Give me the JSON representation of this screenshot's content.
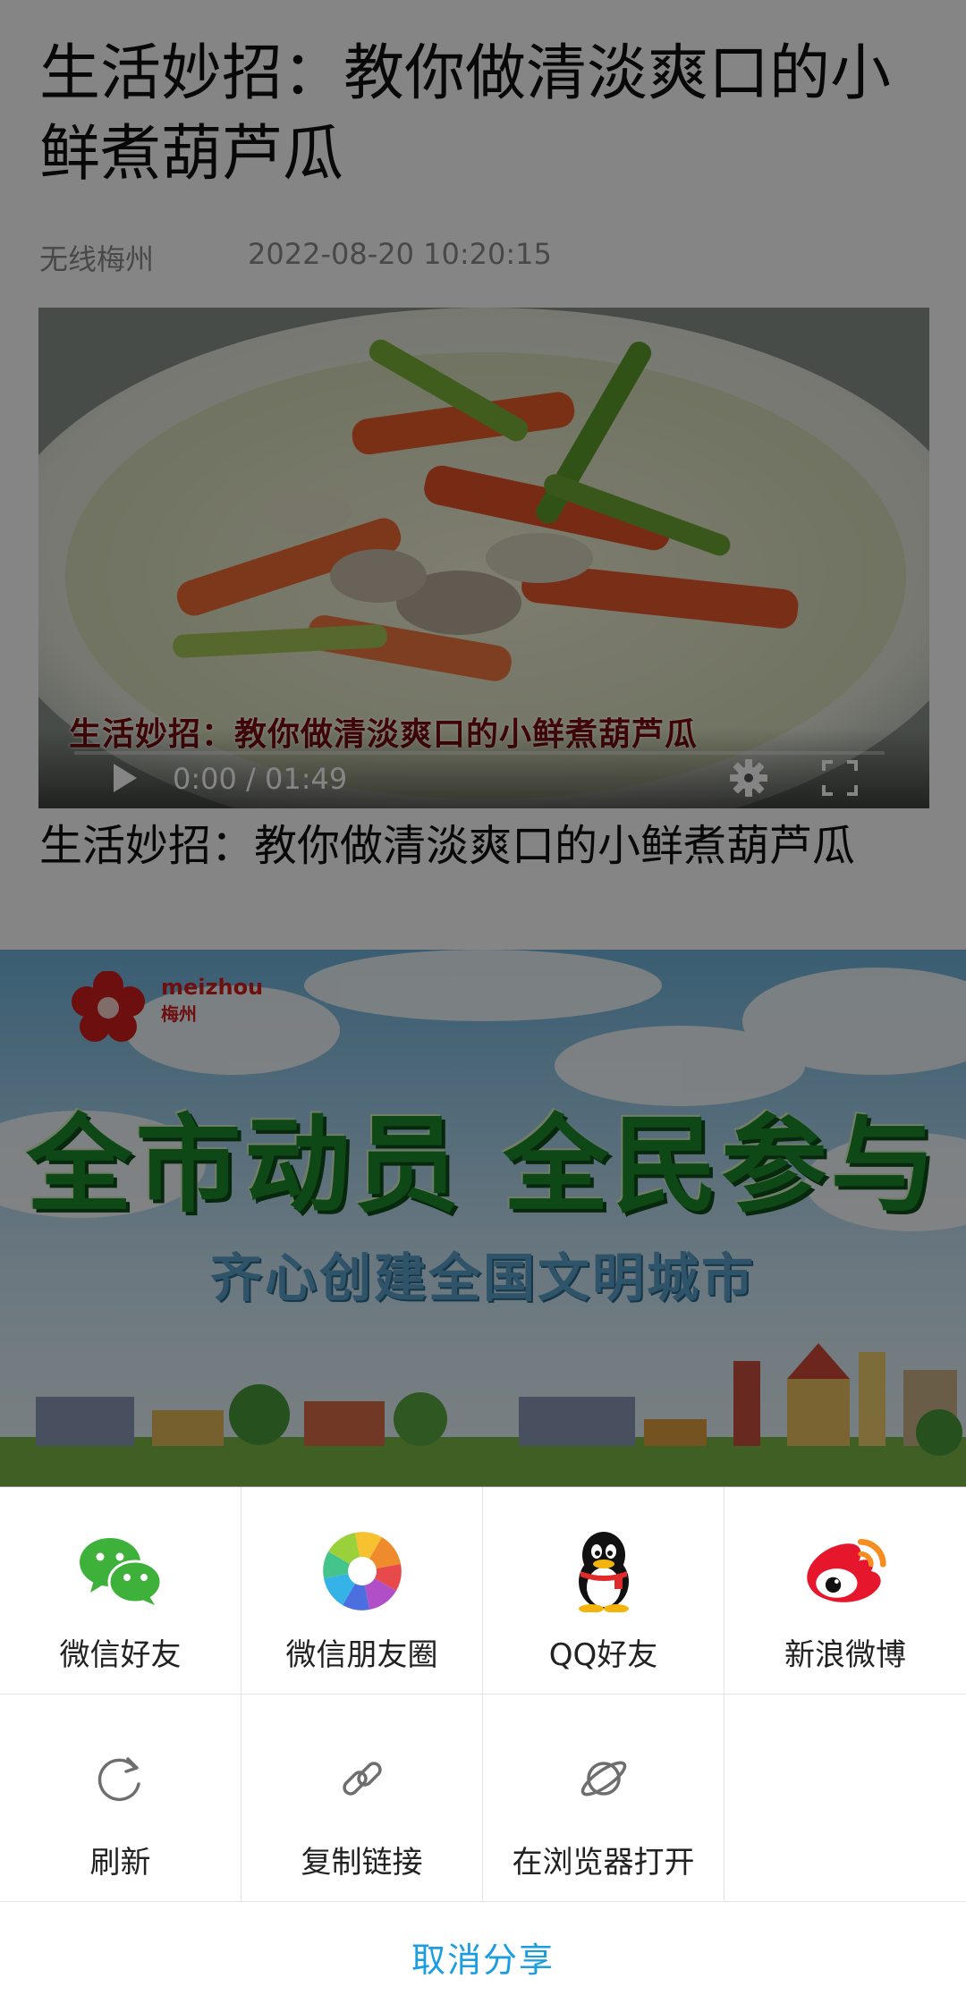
{
  "article": {
    "title": "生活妙招：教你做清淡爽口的小鲜煮葫芦瓜",
    "source": "无线梅州",
    "datetime": "2022-08-20 10:20:15",
    "video": {
      "overlay_caption": "生活妙招：教你做清淡爽口的小鲜煮葫芦瓜",
      "time_readout": "0:00 / 01:49",
      "progress": 0,
      "icons": {
        "play": "play-icon",
        "settings": "gear-icon",
        "fullscreen": "fullscreen-icon"
      }
    },
    "subtitle": "生活妙招：教你做清淡爽口的小鲜煮葫芦瓜",
    "banner": {
      "logo_en": "meizhou",
      "logo_cn": "梅州",
      "headline": "全市动员 全民参与",
      "subline": "齐心创建全国文明城市"
    }
  },
  "share_sheet": {
    "options": [
      {
        "label": "微信好友",
        "icon": "wechat-icon"
      },
      {
        "label": "微信朋友圈",
        "icon": "moments-icon"
      },
      {
        "label": "QQ好友",
        "icon": "qq-icon"
      },
      {
        "label": "新浪微博",
        "icon": "weibo-icon"
      },
      {
        "label": "刷新",
        "icon": "refresh-icon"
      },
      {
        "label": "复制链接",
        "icon": "link-icon"
      },
      {
        "label": "在浏览器打开",
        "icon": "browser-icon"
      }
    ],
    "cancel_label": "取消分享",
    "colors": {
      "accent": "#1b9ee0",
      "divider": "#e3e3e3"
    }
  }
}
